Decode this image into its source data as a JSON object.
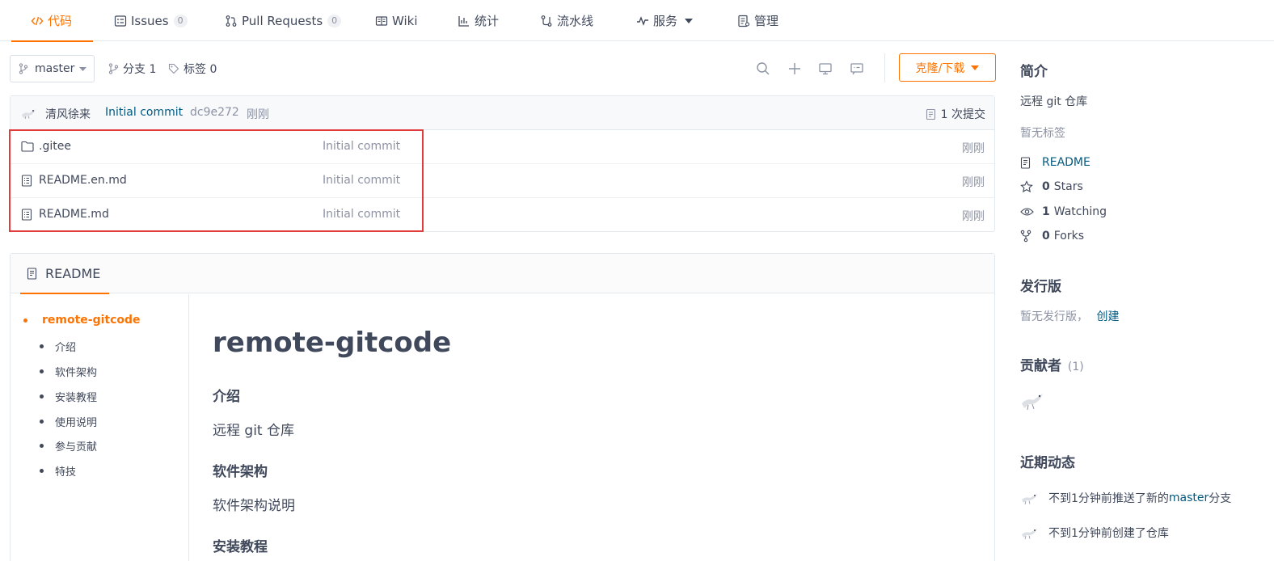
{
  "nav": {
    "tabs": [
      {
        "label": "代码",
        "icon": "code-icon",
        "active": true
      },
      {
        "label": "Issues",
        "icon": "issues-icon",
        "count": "0"
      },
      {
        "label": "Pull Requests",
        "icon": "pull-request-icon",
        "count": "0"
      },
      {
        "label": "Wiki",
        "icon": "wiki-icon"
      },
      {
        "label": "统计",
        "icon": "stats-icon"
      },
      {
        "label": "流水线",
        "icon": "pipeline-icon"
      },
      {
        "label": "服务",
        "icon": "service-icon"
      },
      {
        "label": "管理",
        "icon": "manage-icon"
      }
    ]
  },
  "repo_bar": {
    "branch": "master",
    "branches_label": "分支 1",
    "tags_label": "标签 0",
    "clone_label": "克隆/下载"
  },
  "commit": {
    "author": "清风徐来",
    "message": "Initial commit",
    "sha": "dc9e272",
    "time": "刚刚",
    "count_label": "1 次提交"
  },
  "files": [
    {
      "name": ".gitee",
      "type": "folder",
      "message": "Initial commit",
      "time": "刚刚"
    },
    {
      "name": "README.en.md",
      "type": "file",
      "message": "Initial commit",
      "time": "刚刚"
    },
    {
      "name": "README.md",
      "type": "file",
      "message": "Initial commit",
      "time": "刚刚"
    }
  ],
  "readme": {
    "tab_label": "README",
    "toc": {
      "root": "remote-gitcode",
      "items": [
        "介绍",
        "软件架构",
        "安装教程",
        "使用说明",
        "参与贡献",
        "特技"
      ]
    },
    "content": {
      "title": "remote-gitcode",
      "h_intro": "介绍",
      "p_intro": "远程 git 仓库",
      "h_arch": "软件架构",
      "p_arch": "软件架构说明",
      "h_install": "安装教程"
    }
  },
  "sidebar": {
    "intro_heading": "简介",
    "description": "远程 git 仓库",
    "no_tags": "暂无标签",
    "readme_link": "README",
    "stars_count": "0",
    "stars_label": "Stars",
    "watching_count": "1",
    "watching_label": "Watching",
    "forks_count": "0",
    "forks_label": "Forks",
    "release_heading": "发行版",
    "no_release": "暂无发行版，",
    "create_link": "创建",
    "contrib_heading": "贡献者",
    "contrib_count": "(1)",
    "activity_heading": "近期动态",
    "activities": [
      {
        "before": "不到1分钟前推送了新的 ",
        "link": "master",
        "after": " 分支"
      },
      {
        "before": "不到1分钟前创建了仓库",
        "link": "",
        "after": ""
      }
    ]
  },
  "colors": {
    "accent": "#fe7300",
    "link": "#005980",
    "muted": "#8c92a4",
    "highlight": "#e23b3b"
  }
}
